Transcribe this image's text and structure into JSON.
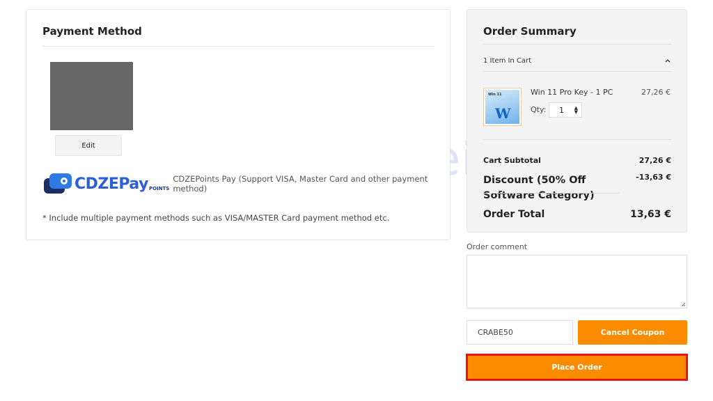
{
  "watermark": {
    "text": "lecrabeinfo"
  },
  "payment": {
    "title": "Payment Method",
    "edit_label": "Edit",
    "provider_logo_text": "CDZEPay",
    "provider_logo_sub": "POINTS",
    "method_label": "CDZEPoints Pay (Support VISA, Master Card and other payment method)",
    "note": "* Include multiple payment methods such as VISA/MASTER Card payment method etc."
  },
  "summary": {
    "title": "Order Summary",
    "items_in_cart": "1 Item In Cart",
    "item": {
      "name": "Win 11 Pro Key - 1 PC",
      "price": "27,26 €",
      "qty_label": "Qty:",
      "qty": "1",
      "thumb_text": "Win 11",
      "thumb_letter": "W"
    },
    "subtotal_label": "Cart Subtotal",
    "subtotal_value": "27,26 €",
    "discount_label": "Discount (50% Off Software Category)",
    "discount_value": "-13,63 €",
    "total_label": "Order Total",
    "total_value": "13,63 €"
  },
  "comment": {
    "label": "Order comment",
    "value": ""
  },
  "coupon": {
    "value": "CRABE50",
    "cancel_label": "Cancel Coupon"
  },
  "place_order_label": "Place Order",
  "colors": {
    "accent": "#fb8c00",
    "highlight_border": "#e8141c",
    "brand_blue": "#2b5fd9"
  },
  "icons": {
    "collapse": "chevron-up-icon",
    "qty_stepper": "up-down-arrows-icon"
  }
}
